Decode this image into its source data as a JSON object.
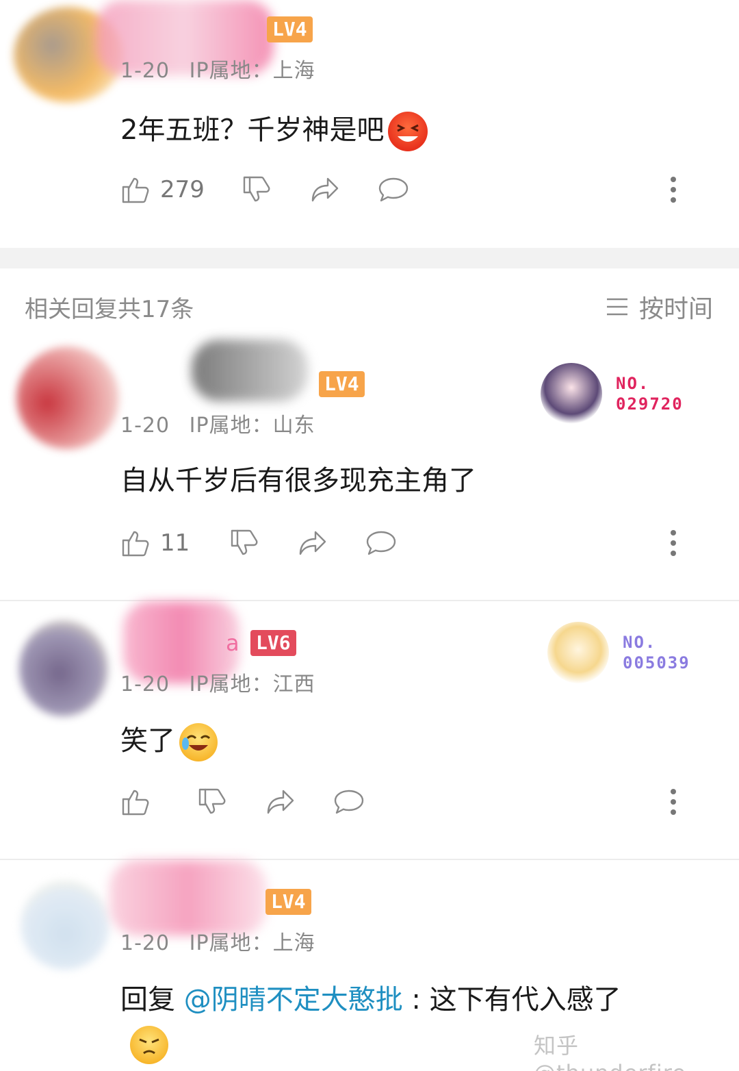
{
  "top_comment": {
    "level": "LV4",
    "ip_location": "IP属地：上海",
    "date_fragment": "1-20",
    "text": "2年五班？千岁神是吧",
    "emoji": "laughing-emoji",
    "likes": "279"
  },
  "replies_header": {
    "title": "相关回复共17条",
    "sort_label": "按时间",
    "sort_icon": "menu-icon"
  },
  "replies": [
    {
      "level": "LV4",
      "date_fragment": "1-20",
      "ip_location": "IP属地：山东",
      "text": "自从千岁后有很多现充主角了",
      "likes": "11",
      "badge": {
        "no_label": "NO.",
        "number": "029720",
        "color": "#e0245e"
      }
    },
    {
      "level": "LV6",
      "name_fragment": "a",
      "date_fragment": "1-20",
      "ip_location": "IP属地：江西",
      "text": "笑了",
      "emoji": "laugh-cry-emoji",
      "likes": "",
      "badge": {
        "no_label": "NO.",
        "number": "005039",
        "color": "#8a7be0"
      }
    },
    {
      "level": "LV4",
      "date_fragment": "1-20",
      "ip_location": "IP属地：上海",
      "reply_prefix": "回复",
      "mention": "@阴晴不定大憨批",
      "text": " : 这下有代入感了",
      "emoji": "annoyed-emoji"
    }
  ],
  "watermark": "知乎 @thunderfire",
  "colors": {
    "lv4": "#f7a44a",
    "lv6": "#e34b5c",
    "mention": "#1f8fc1",
    "separator": "#f2f2f2"
  }
}
